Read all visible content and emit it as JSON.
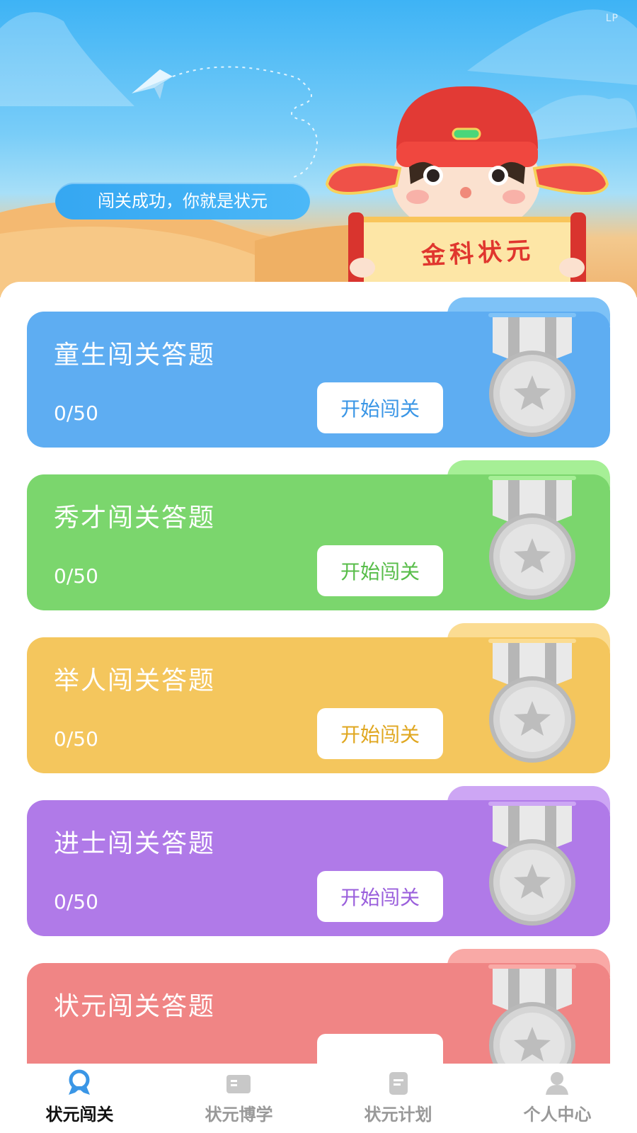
{
  "banner": {
    "watermark": "LP",
    "slogan": "闯关成功，你就是状元",
    "scroll_text": "金科状元"
  },
  "cards": [
    {
      "title": "童生闯关答题",
      "progress": "0/50",
      "button": "开始闯关",
      "color": "#5eadf2",
      "tab_color": "#7ec2f7",
      "btn_text_color": "#3a96e6"
    },
    {
      "title": "秀才闯关答题",
      "progress": "0/50",
      "button": "开始闯关",
      "color": "#7bd66d",
      "tab_color": "#a6ef96",
      "btn_text_color": "#58bd4a"
    },
    {
      "title": "举人闯关答题",
      "progress": "0/50",
      "button": "开始闯关",
      "color": "#f4c65d",
      "tab_color": "#fbdc92",
      "btn_text_color": "#e0a720"
    },
    {
      "title": "进士闯关答题",
      "progress": "0/50",
      "button": "开始闯关",
      "color": "#b07ae8",
      "tab_color": "#cda6f4",
      "btn_text_color": "#9a5fdc"
    },
    {
      "title": "状元闯关答题",
      "progress": "",
      "button": "",
      "color": "#f08585",
      "tab_color": "#f9a9a6",
      "btn_text_color": "#e25b5b"
    }
  ],
  "tabbar": {
    "items": [
      {
        "label": "状元闯关",
        "icon": "badge-icon",
        "active": true
      },
      {
        "label": "状元博学",
        "icon": "book-icon",
        "active": false
      },
      {
        "label": "状元计划",
        "icon": "document-icon",
        "active": false
      },
      {
        "label": "个人中心",
        "icon": "person-icon",
        "active": false
      }
    ]
  },
  "colors": {
    "active_tab": "#3a96e6",
    "inactive_tab": "#c8c8c8"
  }
}
